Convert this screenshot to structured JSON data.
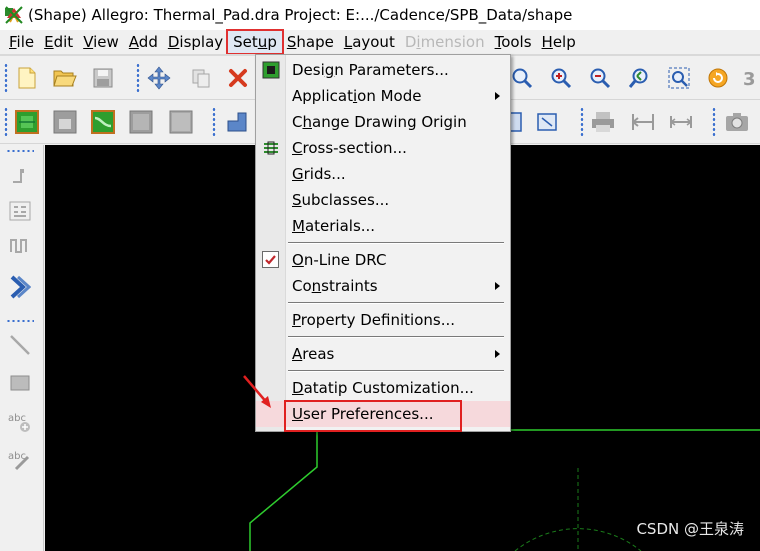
{
  "window": {
    "title": "(Shape) Allegro: Thermal_Pad.dra  Project: E:.../Cadence/SPB_Data/shape"
  },
  "menubar": {
    "items": [
      {
        "pre": "",
        "mn": "F",
        "post": "ile",
        "disabled": false,
        "active": false
      },
      {
        "pre": "",
        "mn": "E",
        "post": "dit",
        "disabled": false,
        "active": false
      },
      {
        "pre": "",
        "mn": "V",
        "post": "iew",
        "disabled": false,
        "active": false
      },
      {
        "pre": "",
        "mn": "A",
        "post": "dd",
        "disabled": false,
        "active": false
      },
      {
        "pre": "",
        "mn": "D",
        "post": "isplay",
        "disabled": false,
        "active": false
      },
      {
        "pre": "Set",
        "mn": "u",
        "post": "p",
        "disabled": false,
        "active": true
      },
      {
        "pre": "",
        "mn": "S",
        "post": "hape",
        "disabled": false,
        "active": false
      },
      {
        "pre": "",
        "mn": "L",
        "post": "ayout",
        "disabled": false,
        "active": false
      },
      {
        "pre": "D",
        "mn": "i",
        "post": "mension",
        "disabled": true,
        "active": false
      },
      {
        "pre": "",
        "mn": "T",
        "post": "ools",
        "disabled": false,
        "active": false
      },
      {
        "pre": "",
        "mn": "H",
        "post": "elp",
        "disabled": false,
        "active": false
      }
    ]
  },
  "setup_menu": {
    "items": [
      {
        "pre": "Desi",
        "mn": "g",
        "post": "n Parameters...",
        "submenu": false
      },
      {
        "pre": "Applicat",
        "mn": "i",
        "post": "on Mode",
        "submenu": true
      },
      {
        "pre": "C",
        "mn": "h",
        "post": "ange Drawing Origin",
        "submenu": false
      },
      {
        "pre": "",
        "mn": "C",
        "post": "ross-section...",
        "submenu": false
      },
      {
        "pre": "",
        "mn": "G",
        "post": "rids...",
        "submenu": false
      },
      {
        "pre": "",
        "mn": "S",
        "post": "ubclasses...",
        "submenu": false
      },
      {
        "pre": "",
        "mn": "M",
        "post": "aterials...",
        "submenu": false
      },
      {
        "pre": "",
        "mn": "O",
        "post": "n-Line DRC",
        "submenu": false,
        "checked": true
      },
      {
        "pre": "Co",
        "mn": "n",
        "post": "straints",
        "submenu": true
      },
      {
        "pre": "",
        "mn": "P",
        "post": "roperty Definitions...",
        "submenu": false
      },
      {
        "pre": "",
        "mn": "A",
        "post": "reas",
        "submenu": true
      },
      {
        "pre": "",
        "mn": "D",
        "post": "atatip Customization...",
        "submenu": false
      },
      {
        "pre": "",
        "mn": "U",
        "post": "ser Preferences...",
        "submenu": false,
        "highlighted": true
      }
    ]
  },
  "watermark": "CSDN @王泉涛",
  "colors": {
    "highlight_box": "#e02020",
    "canvas": "#000000",
    "shape_outline": "#2ecc2e",
    "menu_hover": "#f6d9dc"
  },
  "icons": {
    "toolbar1": [
      "new-file-icon",
      "open-folder-icon",
      "save-icon",
      "move-icon",
      "copy-icon",
      "delete-icon",
      "zoom-icon",
      "zoom-in-icon",
      "zoom-out-icon",
      "zoom-previous-icon",
      "zoom-fit-icon",
      "redraw-icon",
      "3d-view-icon"
    ],
    "toolbar2": [
      "board-green-icon",
      "board-gray-icon",
      "board-route-icon",
      "board-blank-icon",
      "board-outline-icon",
      "step-icon",
      "rect-select-icon",
      "window-icon",
      "printer-icon",
      "dimension-icon",
      "measure-icon",
      "camera-icon"
    ],
    "left": [
      "grid-dots-icon",
      "pin-icon",
      "matrix-icon",
      "wave-icon",
      "chevron-right-icon",
      "line-icon",
      "rectangle-icon",
      "text-add-icon",
      "text-edit-icon"
    ]
  }
}
